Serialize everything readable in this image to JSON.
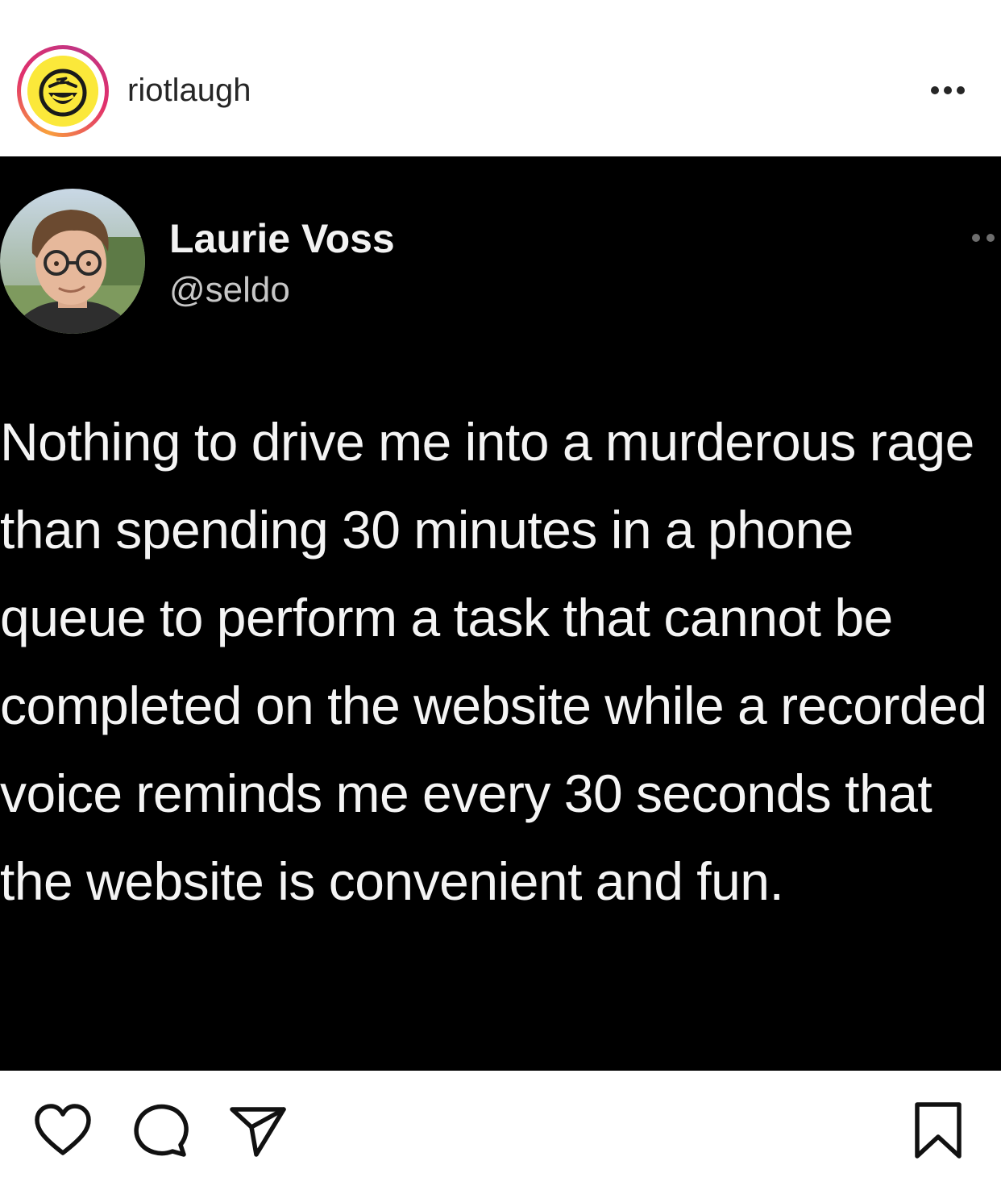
{
  "header": {
    "account_name": "riotlaugh",
    "account_logo_icon": "laughing-face-icon",
    "story_ring_colors": [
      "#f9a03c",
      "#e1306c",
      "#c13584"
    ],
    "more_icon": "more-options-icon"
  },
  "tweet": {
    "author_name": "Laurie Voss",
    "author_handle": "@seldo",
    "text": "Nothing to drive me into a murderous rage than spending 30 minutes in a phone queue to perform a task that cannot be completed on the website while a recorded voice reminds me every 30 seconds that the website is convenient and fun.",
    "background_color": "#000000"
  },
  "actions": {
    "like_icon": "heart-icon",
    "comment_icon": "comment-icon",
    "share_icon": "send-icon",
    "save_icon": "bookmark-icon"
  }
}
